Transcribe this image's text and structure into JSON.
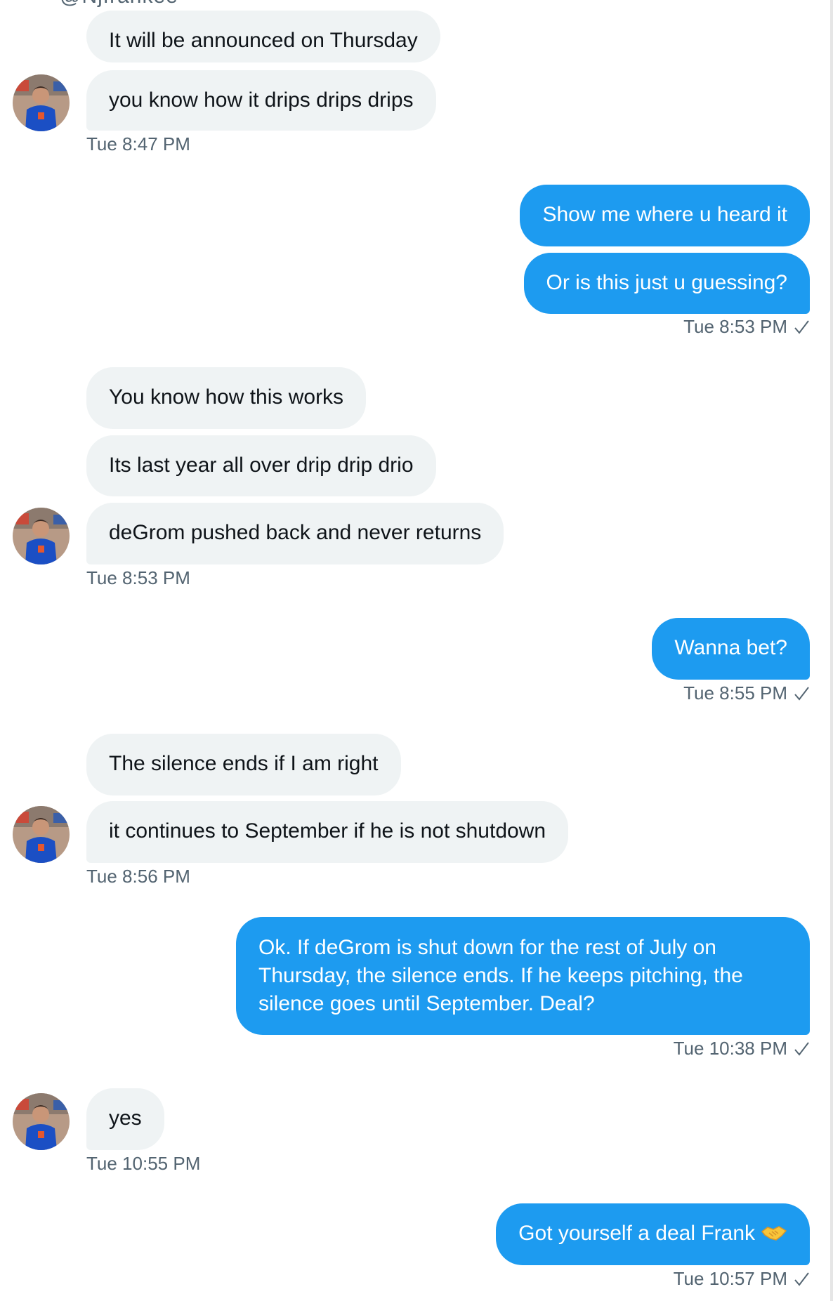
{
  "conversation": {
    "handle_clip": "@Njfrankee",
    "groups": [
      {
        "side": "in",
        "messages": [
          "It will be announced on Thursday",
          "you know how it drips drips drips"
        ],
        "time": "Tue 8:47 PM"
      },
      {
        "side": "out",
        "messages": [
          "Show me where u heard it",
          "Or is this just u guessing?"
        ],
        "time": "Tue 8:53 PM"
      },
      {
        "side": "in",
        "messages": [
          "You know how this works",
          "Its last year all over drip drip drio",
          "deGrom pushed back and never returns"
        ],
        "time": "Tue 8:53 PM"
      },
      {
        "side": "out",
        "messages": [
          "Wanna bet?"
        ],
        "time": "Tue 8:55 PM"
      },
      {
        "side": "in",
        "messages": [
          "The silence ends if I am right",
          "it continues to September if he is not shutdown"
        ],
        "time": "Tue 8:56 PM"
      },
      {
        "side": "out",
        "messages": [
          "Ok. If deGrom is shut down for the rest of July on Thursday, the silence ends. If he keeps pitching, the silence goes until September. Deal?"
        ],
        "time": "Tue 10:38 PM"
      },
      {
        "side": "in",
        "messages": [
          "yes"
        ],
        "time": "Tue 10:55 PM"
      },
      {
        "side": "out",
        "messages": [
          "Got yourself a deal Frank"
        ],
        "time": "Tue 10:57 PM"
      }
    ]
  },
  "colors": {
    "outgoing_bubble": "#1d9bf0",
    "incoming_bubble": "#eff3f4",
    "timestamp": "#536471"
  },
  "icons": {
    "read_receipt": "check-icon",
    "emoji": "handshake-icon",
    "avatar": "avatar"
  }
}
